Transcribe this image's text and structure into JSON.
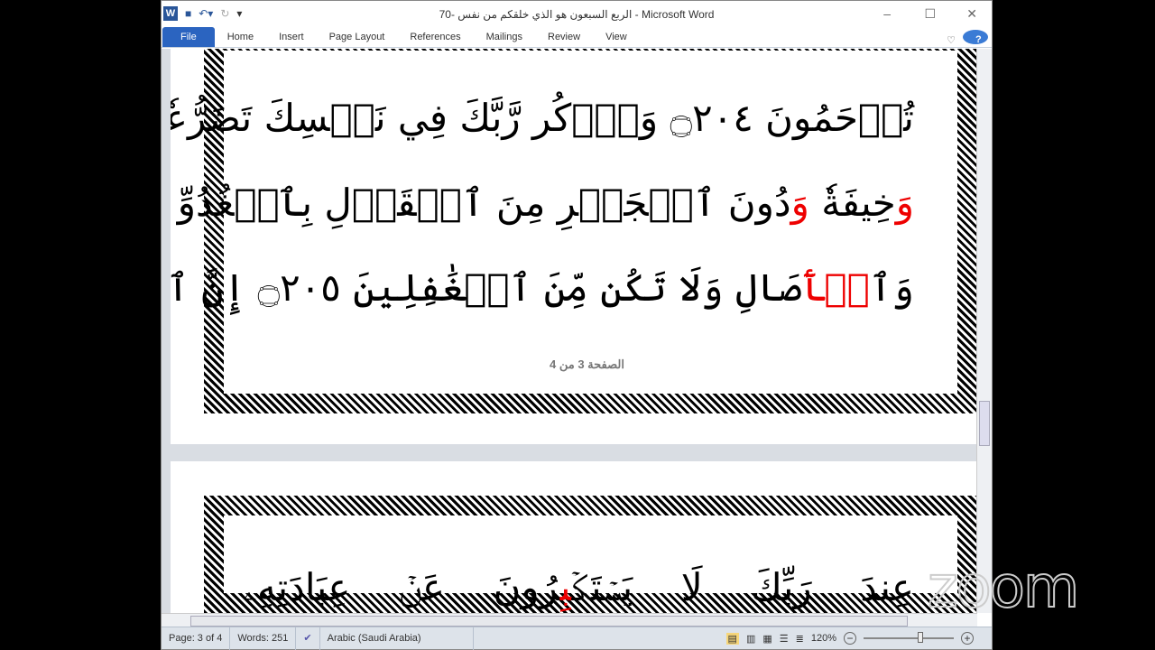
{
  "titlebar": {
    "title": "الربع السبعون هو الذي خلقكم من نفس -70  - Microsoft Word",
    "app_icon": "W"
  },
  "tabs": [
    "File",
    "Home",
    "Insert",
    "Page Layout",
    "References",
    "Mailings",
    "Review",
    "View"
  ],
  "page1": {
    "lines": [
      "تُرۡحَمُونَ ۝٢٠٤ وَٱذۡكُر رَّبَّكَ فِي نَفۡسِكَ تَضَرُّعٗا",
      [
        "وَ",
        "خِيفَةٗ ",
        "وَ",
        "دُونَ ٱلۡجَهۡرِ مِنَ ٱلۡقَوۡلِ بِٱلۡغُدُوِّ"
      ],
      [
        "وَٱ",
        "لۡأٓ",
        "صَالِ وَلَا تَكُن مِّنَ ٱلۡغَٰفِلِينَ ۝٢٠٥ إِنَّ ٱلَّذِينَ"
      ]
    ],
    "page_number": "الصفحة 3 من 4"
  },
  "page2": {
    "line": [
      "عِندَ رَبِّكَ لَا يَسۡتَكۡ",
      "بِ",
      "رُونَ عَنۡ عِبَادَتِهِۦ"
    ]
  },
  "status": {
    "page": "Page: 3 of 4",
    "words": "Words: 251",
    "language": "Arabic (Saudi Arabia)",
    "zoom": "120%",
    "zoom_level": 120
  },
  "watermark": "zoom"
}
